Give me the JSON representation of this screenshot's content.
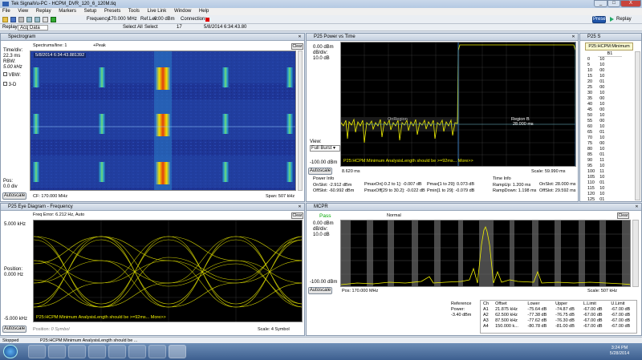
{
  "window": {
    "title": "Tek SignalVu-PC - HCPM_DVR_120_6_120M.tiq",
    "min_label": "_",
    "max_label": "□",
    "close_label": "X"
  },
  "menu": [
    "File",
    "View",
    "Replay",
    "Markers",
    "Setup",
    "Presets",
    "Tools",
    "Live Link",
    "Window",
    "Help"
  ],
  "toolbar": {
    "frequency_label": "Frequency:",
    "frequency_value": "170.000 MHz",
    "reflev_label": "Ref.Lev:",
    "reflev_value": "0.00 dBm",
    "connection_label": "Connection:",
    "preset_label": "Preset",
    "replay_label": "Replay"
  },
  "toolbar2": {
    "replay_label": "Replay:",
    "replay_value": "Acq Data",
    "select_all": "Select All",
    "select_label": "Select",
    "acq_number": "17",
    "timestamp": "5/8/2014 6:34:43.80"
  },
  "spectrogram": {
    "title": "Spectrogram",
    "spectrums_line": "Spectrums/line: 1",
    "peak_mode": "+Peak",
    "timestamp": "5/8/2014 6:34:43.881392",
    "clear": "Clear",
    "time_div_label": "Time/div:",
    "time_div_value": "22.3 ms",
    "rbw_label": "RBW:",
    "rbw_value": "5.00 kHz",
    "vbw_label": "VBW:",
    "threed_label": "3-D",
    "pos_label": "Pos:",
    "pos_value": "0.0 div",
    "autoscale": "Autoscale",
    "cf": "CF: 170.000 MHz",
    "span": "Span: 507 kHz"
  },
  "power_time": {
    "title": "P25 Power vs Time",
    "top_value": "0.00 dBm",
    "db_div_label": "dB/div:",
    "db_div_value": "10.0 dB",
    "view_label": "View:",
    "view_value": "Full Burst",
    "bottom_value": "-100.00 dBm",
    "autoscale": "Autoscale",
    "start": "8.620 ms",
    "scale": "Scale: 59.990 ms",
    "region_a": "OnRegion",
    "region_b": "Region B",
    "region_b_sub": "28.000 ms",
    "warning": "P25:HCPM:Minimum AnalysisLength should be >=92ms... More>>",
    "power_info": "Power Info",
    "time_info": "Time Info",
    "onslot_label": "OnSlot:",
    "onslot_value": "-2.912 dBm",
    "offslot_label": "OffSlot:",
    "offslot_value": "-60.992 dBm",
    "pmaxon_label": "PmaxOn[-0.2 to 1]:",
    "pmaxon_value": "-0.007 dB",
    "pmaxoff_label": "PmaxOff[29 to 30.2]:",
    "pmaxoff_value": "-0.022 dB",
    "pmax_label": "Pmax[1 to 29]:",
    "pmax_value": "0.073 dB",
    "pmin_label": "Pmin[1 to 29]:",
    "pmin_value": "-0.079 dB",
    "rampup_label": "RampUp:",
    "rampup_value": "1.200 ms",
    "rampdown_label": "RampDown:",
    "rampdown_value": "1.198 ms",
    "onslot_t_label": "OnSlot:",
    "onslot_t_value": "28.000 ms",
    "offslot_t_label": "OffSlot:",
    "offslot_t_value": "29.592 ms"
  },
  "symbol_table": {
    "title": "P25 S",
    "header": "P25:HCPM:Minimum",
    "col": "B1",
    "rows": [
      [
        "0",
        "10"
      ],
      [
        "5",
        "10"
      ],
      [
        "10",
        "00"
      ],
      [
        "15",
        "10"
      ],
      [
        "20",
        "01"
      ],
      [
        "25",
        "00"
      ],
      [
        "30",
        "10"
      ],
      [
        "35",
        "00"
      ],
      [
        "40",
        "10"
      ],
      [
        "45",
        "00"
      ],
      [
        "50",
        "10"
      ],
      [
        "55",
        "00"
      ],
      [
        "60",
        "10"
      ],
      [
        "65",
        "01"
      ],
      [
        "70",
        "10"
      ],
      [
        "75",
        "00"
      ],
      [
        "80",
        "10"
      ],
      [
        "85",
        "01"
      ],
      [
        "90",
        "11"
      ],
      [
        "95",
        "10"
      ],
      [
        "100",
        "11"
      ],
      [
        "105",
        "10"
      ],
      [
        "110",
        "01"
      ],
      [
        "115",
        "10"
      ],
      [
        "120",
        "10"
      ],
      [
        "125",
        "01"
      ]
    ]
  },
  "eye": {
    "title": "P25 Eye Diagram - Frequency",
    "freq_error": "Freq Error: 6.212 Hz, Auto",
    "top_value": "5.000 kHz",
    "position_label": "Position:",
    "position_value": "0.000 Hz",
    "bottom_value": "-5.000 kHz",
    "autoscale": "Autoscale",
    "pos_label": "Position:",
    "pos_value": "0 Symbol",
    "scale": "Scale: 4 Symbol",
    "warning": "P25:HCPM:Minimum AnalysisLength should be >=92ms... More>>",
    "clear": "Clear"
  },
  "mcpr": {
    "title": "MCPR",
    "status": "Pass",
    "mode": "Normal",
    "clear": "Clear",
    "top_value": "0.00 dBm",
    "db_div_label": "dB/div:",
    "db_div_value": "10.0 dB",
    "bottom_value": "-100.00 dBm",
    "autoscale": "Autoscale",
    "pos": "Pos: 170.000 MHz",
    "scale": "Scale: 507 kHz",
    "reference_label": "Reference Power:",
    "reference_value": "-3.40 dBm",
    "headers": [
      "Ch",
      "Offset",
      "Lower",
      "Upper",
      "L.Limit",
      "U.Limit"
    ],
    "rows": [
      [
        "A1",
        "21.875 kHz",
        "-75.64 dB",
        "-74.87 dB",
        "-67.00 dB",
        "-67.00 dB"
      ],
      [
        "A2",
        "62.500 kHz",
        "-77.38 dB",
        "-76.75 dB",
        "-67.00 dB",
        "-67.00 dB"
      ],
      [
        "A3",
        "87.500 kHz",
        "-77.62 dB",
        "-76.30 dB",
        "-67.00 dB",
        "-67.00 dB"
      ],
      [
        "A4",
        "150.000 k...",
        "-80.78 dB",
        "-81.00 dB",
        "-67.00 dB",
        "-67.00 dB"
      ]
    ]
  },
  "status": {
    "left": "Stopped",
    "message": "P25:HCPM:Minimum AnalysisLength should be ..."
  },
  "taskbar": {
    "time": "3:24 PM",
    "date": "5/28/2014"
  },
  "colors": {
    "trace_yellow": "#f2f200",
    "spectro_bg": "#1c2f8a",
    "pass_green": "#00a000",
    "connection_red": "#e00000"
  }
}
